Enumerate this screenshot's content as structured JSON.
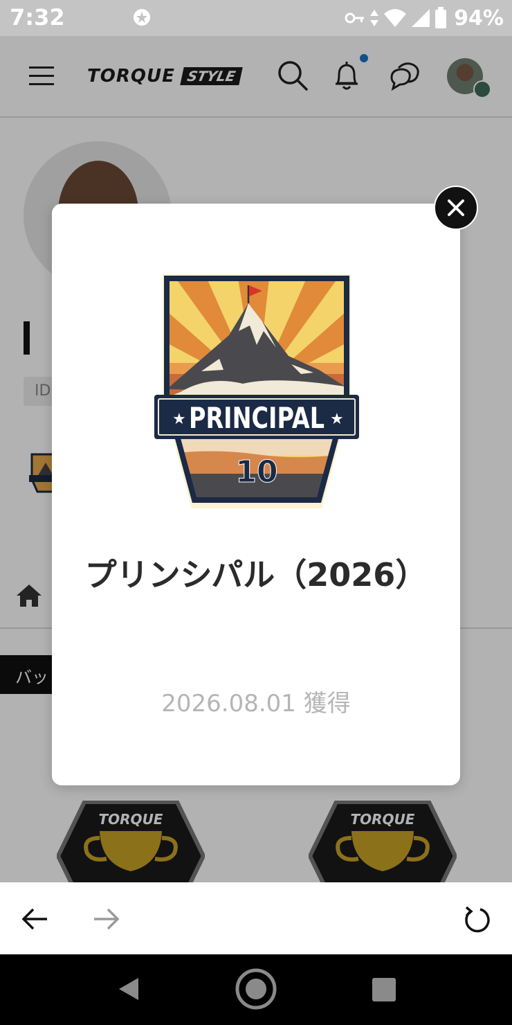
{
  "status_bar": {
    "time": "7:32",
    "battery": "94%"
  },
  "header": {
    "logo_main": "TORQUE",
    "logo_sub": "STYLE",
    "has_notification": true
  },
  "profile": {
    "id_label": "ID",
    "badge_tab_label": "バッ",
    "trophy_label": "TORQUE"
  },
  "dialog": {
    "badge_word": "PRINCIPAL",
    "badge_number": "10",
    "title": "プリンシパル（2026）",
    "date": "2026.08.01 獲得"
  },
  "colors": {
    "overlay": "#000000",
    "notification_dot": "#1a73c7",
    "badge_navy": "#1b2a45",
    "title_text": "#2b2b2b",
    "date_text": "#b5b5b5"
  }
}
